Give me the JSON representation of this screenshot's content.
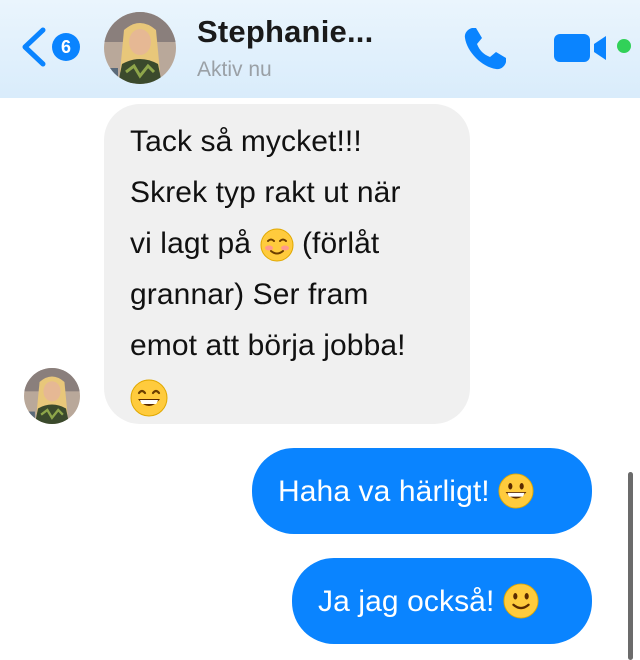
{
  "header": {
    "back_badge_count": "6",
    "contact_name": "Stephanie...",
    "status": "Aktiv nu",
    "active_indicator_color": "#31d158",
    "accent_color": "#0a84ff",
    "icons": [
      "chevron-left-icon",
      "phone-icon",
      "video-camera-icon"
    ]
  },
  "messages": [
    {
      "direction": "incoming",
      "lines": [
        "Tack så mycket!!!",
        "Skrek typ rakt ut när",
        "vi lagt på",
        "(förlåt",
        "grannar) Ser fram",
        "emot att börja jobba!"
      ],
      "emojis": [
        "smiling-blush-emoji",
        "grinning-emoji"
      ]
    },
    {
      "direction": "outgoing",
      "text": "Haha va härligt!",
      "emoji": "grinning-emoji"
    },
    {
      "direction": "outgoing",
      "text": "Ja jag också!",
      "emoji": "slight-smile-emoji"
    }
  ]
}
